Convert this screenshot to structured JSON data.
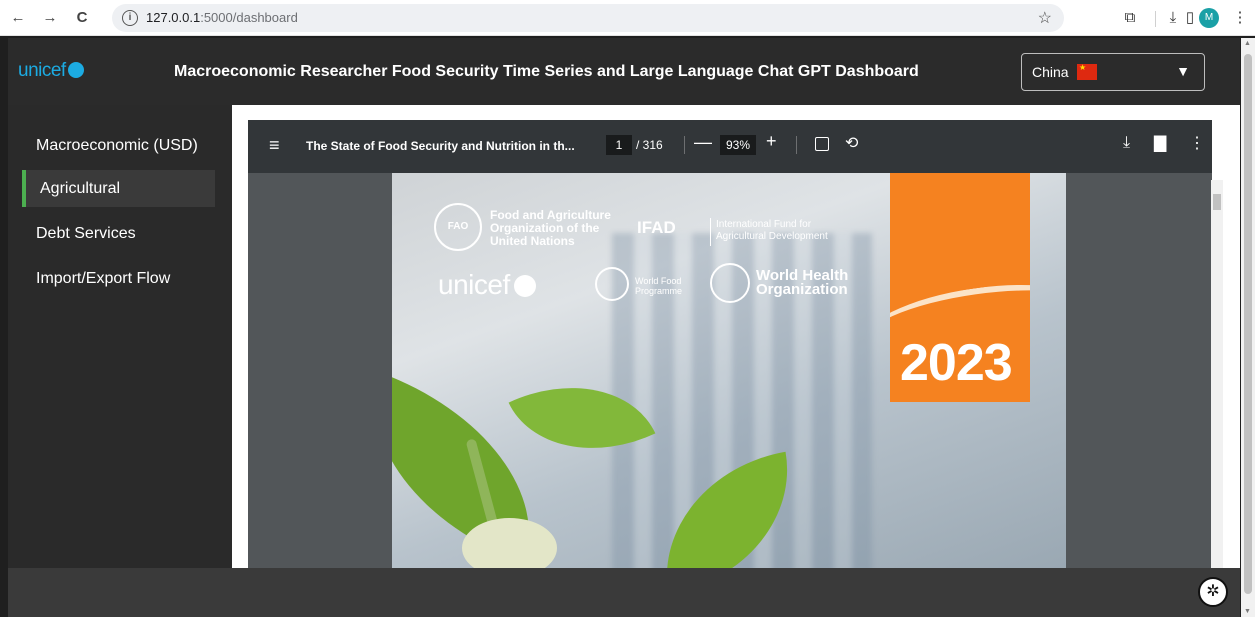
{
  "browser": {
    "back": "←",
    "forward": "→",
    "reload": "C",
    "info": "i",
    "url_host": "127.0.0.1",
    "url_path": ":5000/dashboard",
    "star": "☆",
    "extensions": "⧉",
    "download": "⤓",
    "sidebar": "▯",
    "profile_initial": "M",
    "menu": "⋮"
  },
  "header": {
    "logo": "unicef",
    "title": "Macroeconomic Researcher Food Security Time Series and Large Language Chat GPT Dashboard",
    "country": "China",
    "caret": "▼"
  },
  "sidebar": {
    "items": [
      {
        "label": "Macroeconomic (USD)"
      },
      {
        "label": "Agricultural"
      },
      {
        "label": "Debt Services"
      },
      {
        "label": "Import/Export Flow"
      }
    ],
    "active_index": 1
  },
  "pdf_viewer": {
    "menu": "≡",
    "title": "The State of Food Security and Nutrition in th...",
    "page_current": "1",
    "page_total": "/ 316",
    "zoom_minus": "—",
    "zoom": "93%",
    "zoom_plus": "+",
    "rotate": "⟲",
    "download": "⤓",
    "print": "▇",
    "more": "⋮"
  },
  "cover": {
    "fao": [
      "Food and Agriculture",
      "Organization of the",
      "United Nations"
    ],
    "ifad": "IFAD",
    "ifad_desc": [
      "International Fund for",
      "Agricultural Development"
    ],
    "unicef": "unicef",
    "wfp": [
      "World Food",
      "Programme"
    ],
    "who": [
      "World Health",
      "Organization"
    ],
    "year": "2023"
  },
  "footer": {
    "chatgpt_icon": "✲"
  },
  "colors": {
    "accent_green": "#4caf50",
    "unicef_blue": "#1cabe2",
    "cover_orange": "#f58220"
  }
}
